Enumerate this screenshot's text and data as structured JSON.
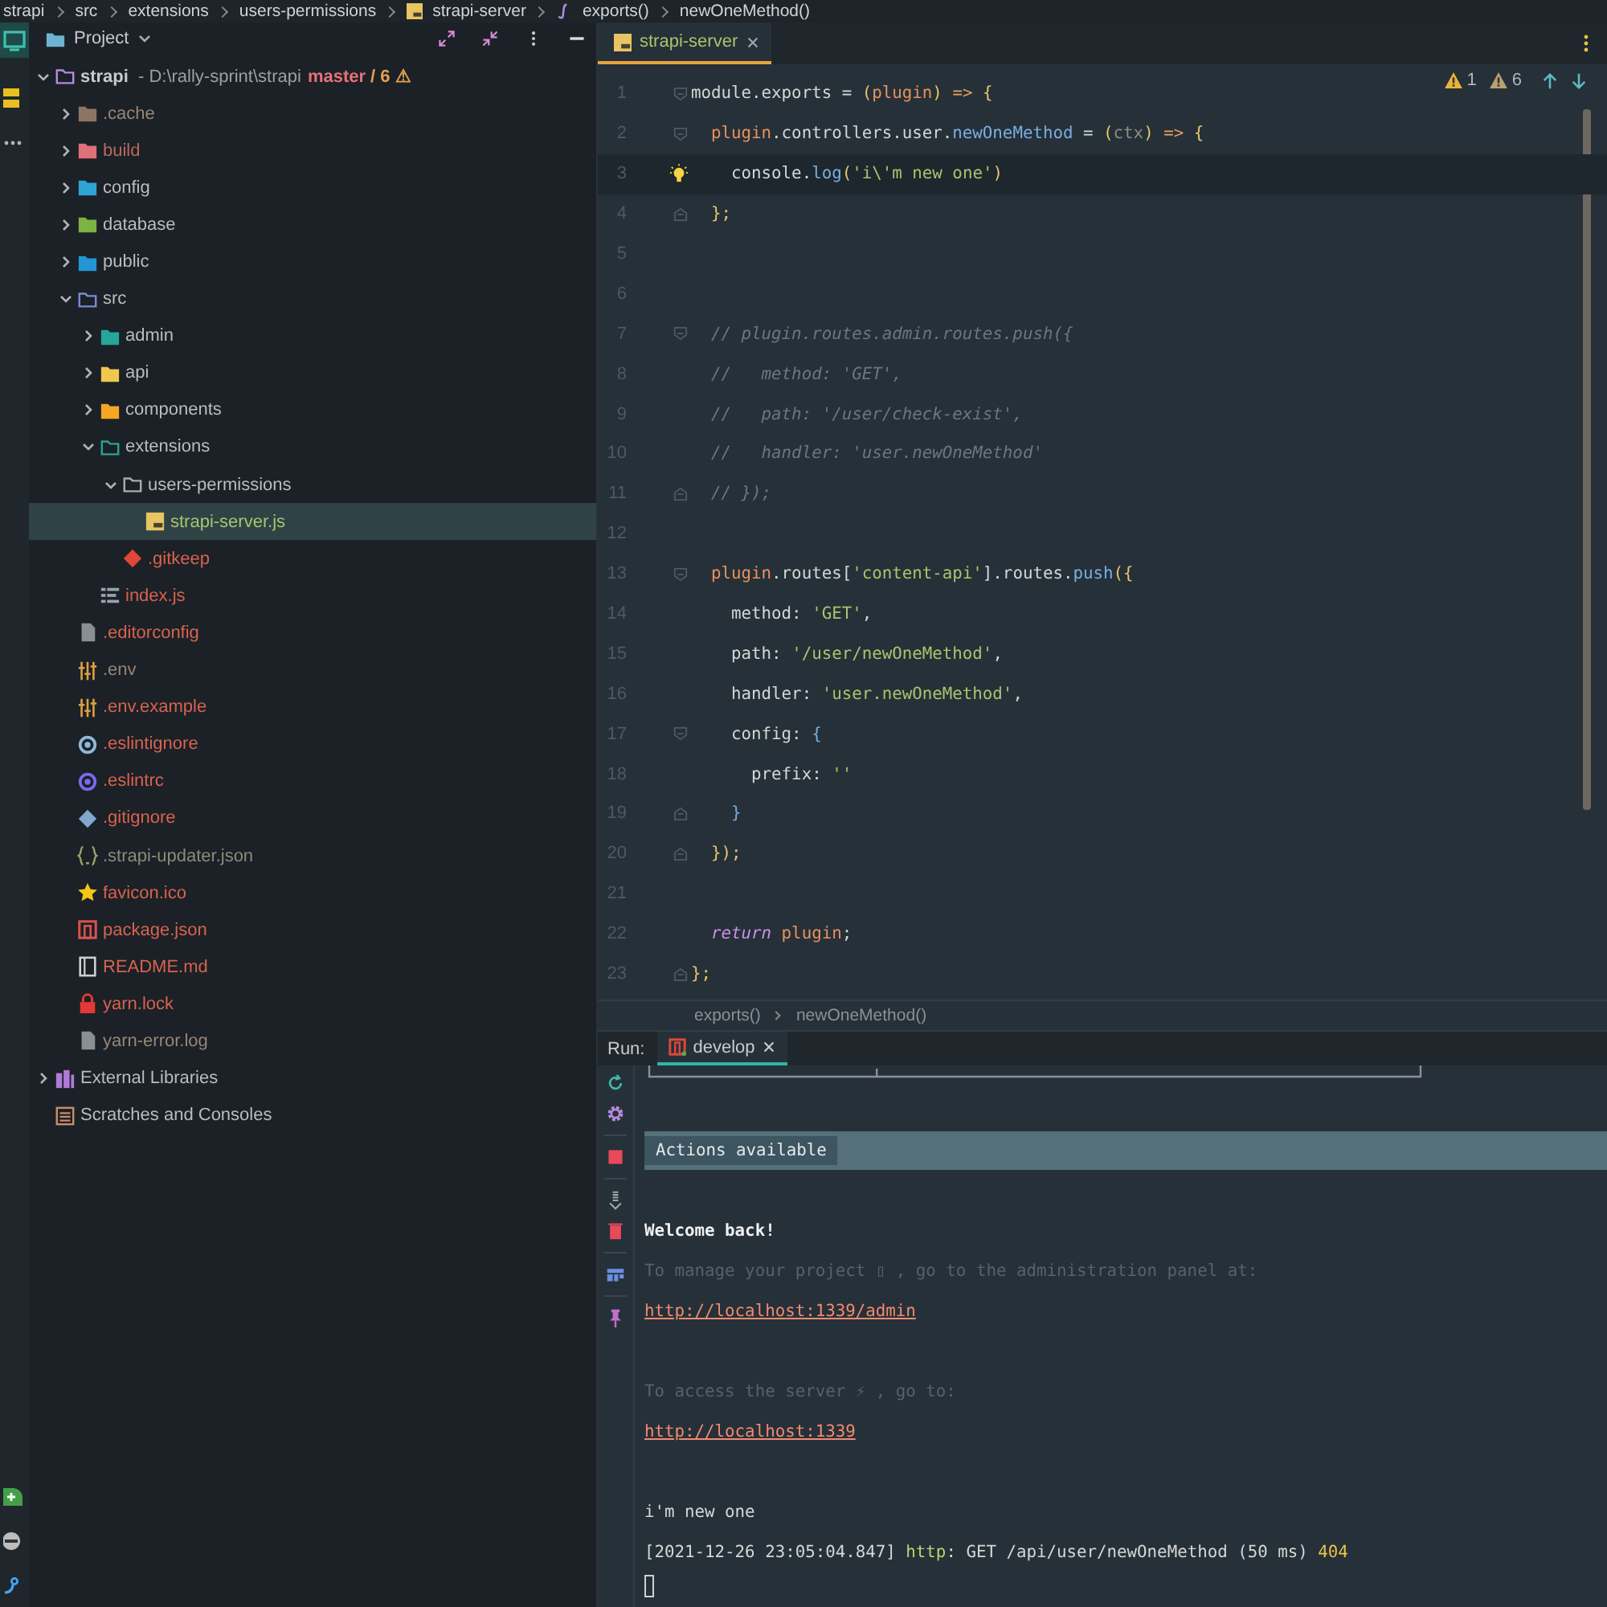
{
  "breadcrumb": [
    {
      "label": "strapi",
      "kind": "plain"
    },
    {
      "label": "src",
      "kind": "plain"
    },
    {
      "label": "extensions",
      "kind": "plain"
    },
    {
      "label": "users-permissions",
      "kind": "plain"
    },
    {
      "label": "strapi-server",
      "kind": "js"
    },
    {
      "label": "exports()",
      "kind": "function"
    },
    {
      "label": "newOneMethod()",
      "kind": "plain"
    }
  ],
  "project": {
    "title": "Project",
    "tree": [
      {
        "name": "strapi",
        "kind": "project",
        "location": "- D:\\rally-sprint\\strapi",
        "branch": "master",
        "changes": "/ 6 ⚠",
        "color": "#c8cbce",
        "expanded": true,
        "selected": false,
        "children": [
          {
            "name": ".cache",
            "kind": "folder-cache",
            "color": "#9a8577",
            "expanded": false,
            "selected": false
          },
          {
            "name": "build",
            "kind": "folder-build",
            "color": "#b86a5c",
            "expanded": false,
            "selected": false
          },
          {
            "name": "config",
            "kind": "folder-config",
            "color": "#b9bcc0",
            "expanded": false,
            "selected": false
          },
          {
            "name": "database",
            "kind": "folder-database",
            "color": "#b9bcc0",
            "expanded": false,
            "selected": false
          },
          {
            "name": "public",
            "kind": "folder-public",
            "color": "#b9bcc0",
            "expanded": false,
            "selected": false
          },
          {
            "name": "src",
            "kind": "folder-src",
            "color": "#b9bcc0",
            "expanded": true,
            "selected": false,
            "children": [
              {
                "name": "admin",
                "kind": "folder-admin",
                "color": "#b9bcc0",
                "expanded": false,
                "selected": false
              },
              {
                "name": "api",
                "kind": "folder-api",
                "color": "#b9bcc0",
                "expanded": false,
                "selected": false
              },
              {
                "name": "components",
                "kind": "folder-components",
                "color": "#b9bcc0",
                "expanded": false,
                "selected": false
              },
              {
                "name": "extensions",
                "kind": "folder-extensions",
                "color": "#b9bcc0",
                "expanded": true,
                "selected": false,
                "children": [
                  {
                    "name": "users-permissions",
                    "kind": "folder",
                    "color": "#b9bcc0",
                    "expanded": true,
                    "selected": false,
                    "children": [
                      {
                        "name": "strapi-server.js",
                        "kind": "js",
                        "color": "#a9c46c",
                        "selected": true
                      }
                    ]
                  },
                  {
                    "name": ".gitkeep",
                    "kind": "gitkeep",
                    "color": "#d9624f",
                    "selected": false
                  }
                ]
              },
              {
                "name": "index.js",
                "kind": "index",
                "color": "#d9624f",
                "selected": false
              }
            ]
          },
          {
            "name": ".editorconfig",
            "kind": "editorconfig",
            "color": "#d9624f",
            "selected": false
          },
          {
            "name": ".env",
            "kind": "env",
            "color": "#9a8577",
            "selected": false
          },
          {
            "name": ".env.example",
            "kind": "env",
            "color": "#d9624f",
            "selected": false
          },
          {
            "name": ".eslintignore",
            "kind": "eslintignore",
            "color": "#d9624f",
            "selected": false
          },
          {
            "name": ".eslintrc",
            "kind": "eslintrc",
            "color": "#d9624f",
            "selected": false
          },
          {
            "name": ".gitignore",
            "kind": "gitignore",
            "color": "#d9624f",
            "selected": false
          },
          {
            "name": ".strapi-updater.json",
            "kind": "json",
            "color": "#8f8a7a",
            "selected": false
          },
          {
            "name": "favicon.ico",
            "kind": "favicon",
            "color": "#d9624f",
            "selected": false
          },
          {
            "name": "package.json",
            "kind": "npm",
            "color": "#d9624f",
            "selected": false
          },
          {
            "name": "README.md",
            "kind": "readme",
            "color": "#d9624f",
            "selected": false
          },
          {
            "name": "yarn.lock",
            "kind": "lock",
            "color": "#d9624f",
            "selected": false
          },
          {
            "name": "yarn-error.log",
            "kind": "log",
            "color": "#9a8577",
            "selected": false
          }
        ]
      },
      {
        "name": "External Libraries",
        "kind": "library",
        "color": "#b9bcc0",
        "expanded": false,
        "selected": false
      },
      {
        "name": "Scratches and Consoles",
        "kind": "scratches",
        "color": "#b9bcc0",
        "selected": false
      }
    ]
  },
  "editor": {
    "tabs": [
      {
        "label": "strapi-server",
        "selected": true
      }
    ],
    "inspections": {
      "warnings": "1",
      "weak_warnings": "6"
    },
    "lines": [
      {
        "number": "1",
        "fold_open": true,
        "tokens": [
          {
            "text": "module.exports = ",
            "kind": "plain"
          },
          {
            "text": "(",
            "kind": "punc"
          },
          {
            "text": "plugin",
            "kind": "param"
          },
          {
            "text": ") ",
            "kind": "punc"
          },
          {
            "text": "=>",
            "kind": "op"
          },
          {
            "text": " {",
            "kind": "punc"
          }
        ]
      },
      {
        "number": "2",
        "fold_open": true,
        "tokens": [
          {
            "text": "  plugin",
            "kind": "param"
          },
          {
            "text": ".controllers.user.",
            "kind": "plain"
          },
          {
            "text": "newOneMethod",
            "kind": "fn"
          },
          {
            "text": " = ",
            "kind": "plain"
          },
          {
            "text": "(",
            "kind": "punc"
          },
          {
            "text": "ctx",
            "kind": "dim"
          },
          {
            "text": ") ",
            "kind": "punc"
          },
          {
            "text": "=>",
            "kind": "op"
          },
          {
            "text": " {",
            "kind": "punc"
          }
        ]
      },
      {
        "number": "3",
        "current": true,
        "bulb": true,
        "tokens": [
          {
            "text": "    console.",
            "kind": "plain"
          },
          {
            "text": "log",
            "kind": "fn"
          },
          {
            "text": "(",
            "kind": "punc"
          },
          {
            "text": "'i\\'m new one'",
            "kind": "str"
          },
          {
            "text": ")",
            "kind": "punc"
          }
        ]
      },
      {
        "number": "4",
        "fold_close": true,
        "tokens": [
          {
            "text": "  };",
            "kind": "punc"
          }
        ]
      },
      {
        "number": "5"
      },
      {
        "number": "6"
      },
      {
        "number": "7",
        "fold_open": true,
        "tokens": [
          {
            "text": "  // plugin.routes.admin.routes.push({",
            "kind": "cmt"
          }
        ]
      },
      {
        "number": "8",
        "tokens": [
          {
            "text": "  //   method: 'GET',",
            "kind": "cmt"
          }
        ]
      },
      {
        "number": "9",
        "tokens": [
          {
            "text": "  //   path: '/user/check-exist',",
            "kind": "cmt"
          }
        ]
      },
      {
        "number": "10",
        "tokens": [
          {
            "text": "  //   handler: 'user.newOneMethod'",
            "kind": "cmt"
          }
        ]
      },
      {
        "number": "11",
        "fold_close": true,
        "tokens": [
          {
            "text": "  // });",
            "kind": "cmt"
          }
        ]
      },
      {
        "number": "12"
      },
      {
        "number": "13",
        "fold_open": true,
        "tokens": [
          {
            "text": "  plugin",
            "kind": "param"
          },
          {
            "text": ".routes[",
            "kind": "plain"
          },
          {
            "text": "'content-api'",
            "kind": "str"
          },
          {
            "text": "].routes.",
            "kind": "plain"
          },
          {
            "text": "push",
            "kind": "fn"
          },
          {
            "text": "({",
            "kind": "punc"
          }
        ]
      },
      {
        "number": "14",
        "tokens": [
          {
            "text": "    method: ",
            "kind": "plain"
          },
          {
            "text": "'GET'",
            "kind": "str"
          },
          {
            "text": ",",
            "kind": "plain"
          }
        ]
      },
      {
        "number": "15",
        "tokens": [
          {
            "text": "    path: ",
            "kind": "plain"
          },
          {
            "text": "'/user/newOneMethod'",
            "kind": "str"
          },
          {
            "text": ",",
            "kind": "plain"
          }
        ]
      },
      {
        "number": "16",
        "tokens": [
          {
            "text": "    handler: ",
            "kind": "plain"
          },
          {
            "text": "'user.newOneMethod'",
            "kind": "str"
          },
          {
            "text": ",",
            "kind": "plain"
          }
        ]
      },
      {
        "number": "17",
        "fold_open": true,
        "tokens": [
          {
            "text": "    config: ",
            "kind": "plain"
          },
          {
            "text": "{",
            "kind": "fn"
          }
        ]
      },
      {
        "number": "18",
        "tokens": [
          {
            "text": "      prefix: ",
            "kind": "plain"
          },
          {
            "text": "''",
            "kind": "str"
          }
        ]
      },
      {
        "number": "19",
        "fold_close": true,
        "tokens": [
          {
            "text": "    }",
            "kind": "fn"
          }
        ]
      },
      {
        "number": "20",
        "fold_close": true,
        "tokens": [
          {
            "text": "  });",
            "kind": "punc"
          }
        ]
      },
      {
        "number": "21"
      },
      {
        "number": "22",
        "tokens": [
          {
            "text": "  return",
            "kind": "kw"
          },
          {
            "text": " plugin",
            "kind": "param"
          },
          {
            "text": ";",
            "kind": "plain"
          }
        ]
      },
      {
        "number": "23",
        "fold_close": true,
        "tokens": [
          {
            "text": "};",
            "kind": "punc"
          }
        ]
      }
    ],
    "breadcrumb": [
      "exports()",
      "newOneMethod()"
    ]
  },
  "run": {
    "label": "Run:",
    "tabs": [
      {
        "label": "develop",
        "selected": true
      }
    ],
    "console": [
      {
        "kind": "box"
      },
      {
        "kind": "blank"
      },
      {
        "kind": "banner",
        "text": "Actions available"
      },
      {
        "kind": "blank"
      },
      {
        "kind": "bold",
        "text": "Welcome back!"
      },
      {
        "kind": "dim",
        "text": "To manage your project ▯ , go to the administration panel at:"
      },
      {
        "kind": "link",
        "text": "http://localhost:1339/admin"
      },
      {
        "kind": "blank"
      },
      {
        "kind": "dim",
        "text": "To access the server ⚡ , go to:"
      },
      {
        "kind": "link",
        "text": "http://localhost:1339"
      },
      {
        "kind": "blank"
      },
      {
        "kind": "plain",
        "text": "i'm new one"
      },
      {
        "kind": "log",
        "tokens": [
          {
            "text": "[2021-12-26 23:05:04.847] ",
            "kind": "plain"
          },
          {
            "text": "http",
            "kind": "green"
          },
          {
            "text": ": GET /api/user/newOneMethod (50 ms) ",
            "kind": "plain"
          },
          {
            "text": "404",
            "kind": "yellow"
          }
        ]
      },
      {
        "kind": "cursor"
      }
    ]
  }
}
